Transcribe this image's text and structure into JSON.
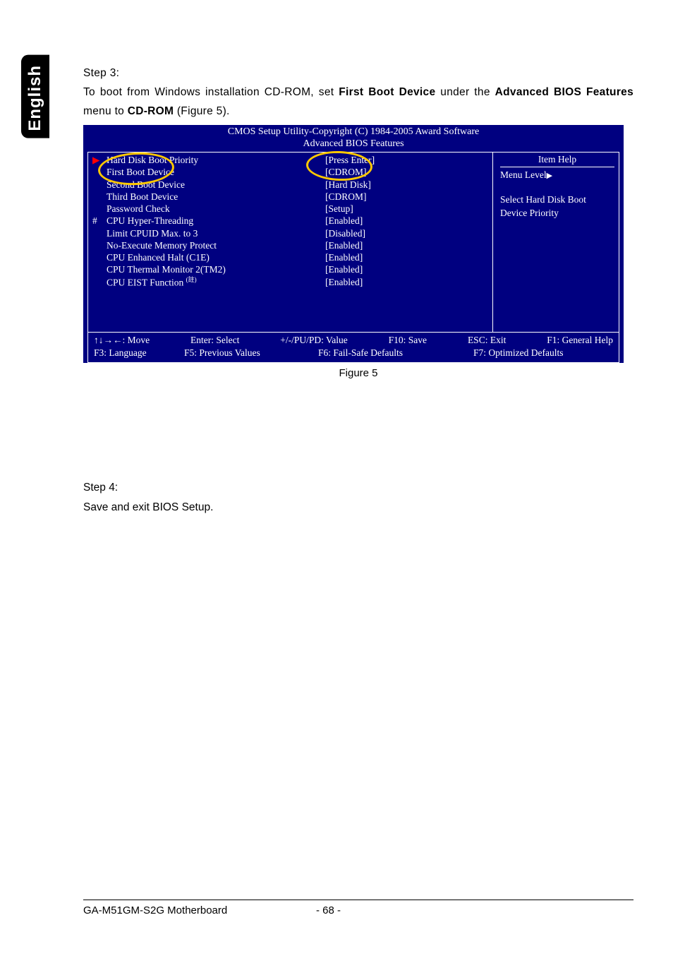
{
  "sidebar": {
    "language": "English"
  },
  "step3": {
    "heading": "Step 3:",
    "line_a": "To boot from Windows installation CD-ROM, set ",
    "line_b": "First Boot Device",
    "line_c": " under the ",
    "line_d": "Advanced BIOS Features",
    "line_e": " menu to ",
    "line_f": "CD-ROM",
    "line_g": "  (Figure 5)."
  },
  "bios": {
    "title1": "CMOS Setup Utility-Copyright (C) 1984-2005 Award Software",
    "title2": "Advanced BIOS Features",
    "rows": [
      {
        "prefix": "▶",
        "label": "Hard Disk Boot Priority",
        "value": "[Press Enter]"
      },
      {
        "prefix": "",
        "label": "First Boot Device",
        "value": "[CDROM]"
      },
      {
        "prefix": "",
        "label": "Second Boot Device",
        "value": "[Hard Disk]"
      },
      {
        "prefix": "",
        "label": "Third Boot Device",
        "value": "[CDROM]"
      },
      {
        "prefix": "",
        "label": "Password Check",
        "value": "[Setup]"
      },
      {
        "prefix": "#",
        "label": "CPU Hyper-Threading",
        "value": "[Enabled]"
      },
      {
        "prefix": "",
        "label": "Limit CPUID Max. to 3",
        "value": "[Disabled]"
      },
      {
        "prefix": "",
        "label": "No-Execute Memory Protect",
        "value": "[Enabled]"
      },
      {
        "prefix": "",
        "label": "CPU Enhanced Halt (C1E)",
        "value": "[Enabled]"
      },
      {
        "prefix": "",
        "label": "CPU Thermal Monitor 2(TM2)",
        "value": "[Enabled]"
      },
      {
        "prefix": "",
        "label": "CPU EIST Function",
        "sup": "(註)",
        "value": "[Enabled]"
      }
    ],
    "help": {
      "title": "Item Help",
      "menulevel": "Menu Level",
      "line1": "Select Hard Disk Boot",
      "line2": "Device Priority"
    },
    "footer": {
      "r1c1": "↑↓→←: Move",
      "r1c2": "Enter: Select",
      "r1c3": "+/-/PU/PD: Value",
      "r1c4": "F10: Save",
      "r1c5": "ESC: Exit",
      "r1c6": "F1: General Help",
      "r2c1": "F3: Language",
      "r2c2": "F5: Previous Values",
      "r2c3": "F6: Fail-Safe Defaults",
      "r2c4": "F7: Optimized Defaults"
    }
  },
  "figcaption": "Figure 5",
  "step4": {
    "heading": "Step 4:",
    "text": "Save and exit BIOS Setup."
  },
  "footer": {
    "left": "GA-M51GM-S2G Motherboard",
    "center": "- 68 -"
  }
}
